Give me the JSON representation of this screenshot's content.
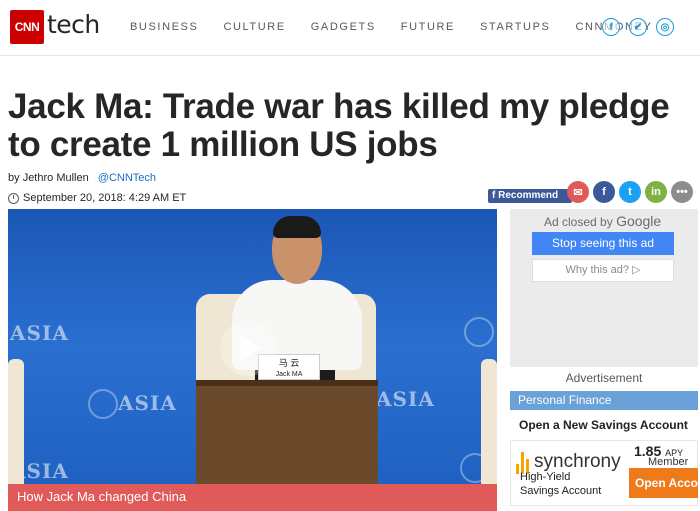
{
  "header": {
    "logo_text": "CNN",
    "section": "tech",
    "nav": [
      "BUSINESS",
      "CULTURE",
      "GADGETS",
      "FUTURE",
      "STARTUPS",
      "CNNMONEY"
    ],
    "social_icons": [
      "facebook-icon",
      "twitter-icon",
      "instagram-icon"
    ]
  },
  "article": {
    "headline": "Jack Ma: Trade war has killed my pledge to create 1 million US jobs",
    "author_prefix": "by",
    "author": "Jethro Mullen",
    "handle": "@CNNTech",
    "date": "September 20, 2018: 4:29 AM ET"
  },
  "share": {
    "recommend_label": "Recommend",
    "icons": [
      "email-icon",
      "facebook-icon",
      "twitter-icon",
      "linkedin-icon",
      "more-icon"
    ]
  },
  "video": {
    "nameplate": "马 云",
    "nameplate_sub": "Jack MA",
    "watermark": "ASIA",
    "caption": "How Jack Ma changed China"
  },
  "ad": {
    "closed_by": "Ad closed by",
    "google": "Google",
    "stop_label": "Stop seeing this ad",
    "why_label": "Why this ad? ▷",
    "advertisement_label": "Advertisement"
  },
  "finance": {
    "header": "Personal Finance",
    "offer": "Open a New Savings Account",
    "brand": "synchrony",
    "apy_value": "1.85",
    "apy_unit": "APY",
    "member_label": "Member",
    "product_line1": "High-Yield",
    "product_line2": "Savings Account",
    "open_label": "Open Acco"
  },
  "colors": {
    "cnn_red": "#cc0000",
    "link_blue": "#1a6ec6",
    "caption_bg": "#e05a5a",
    "pf_header_bg": "#6aa1d8",
    "google_blue": "#4285f4",
    "synchrony_gold": "#f5a500",
    "open_orange": "#ef7a1a"
  }
}
